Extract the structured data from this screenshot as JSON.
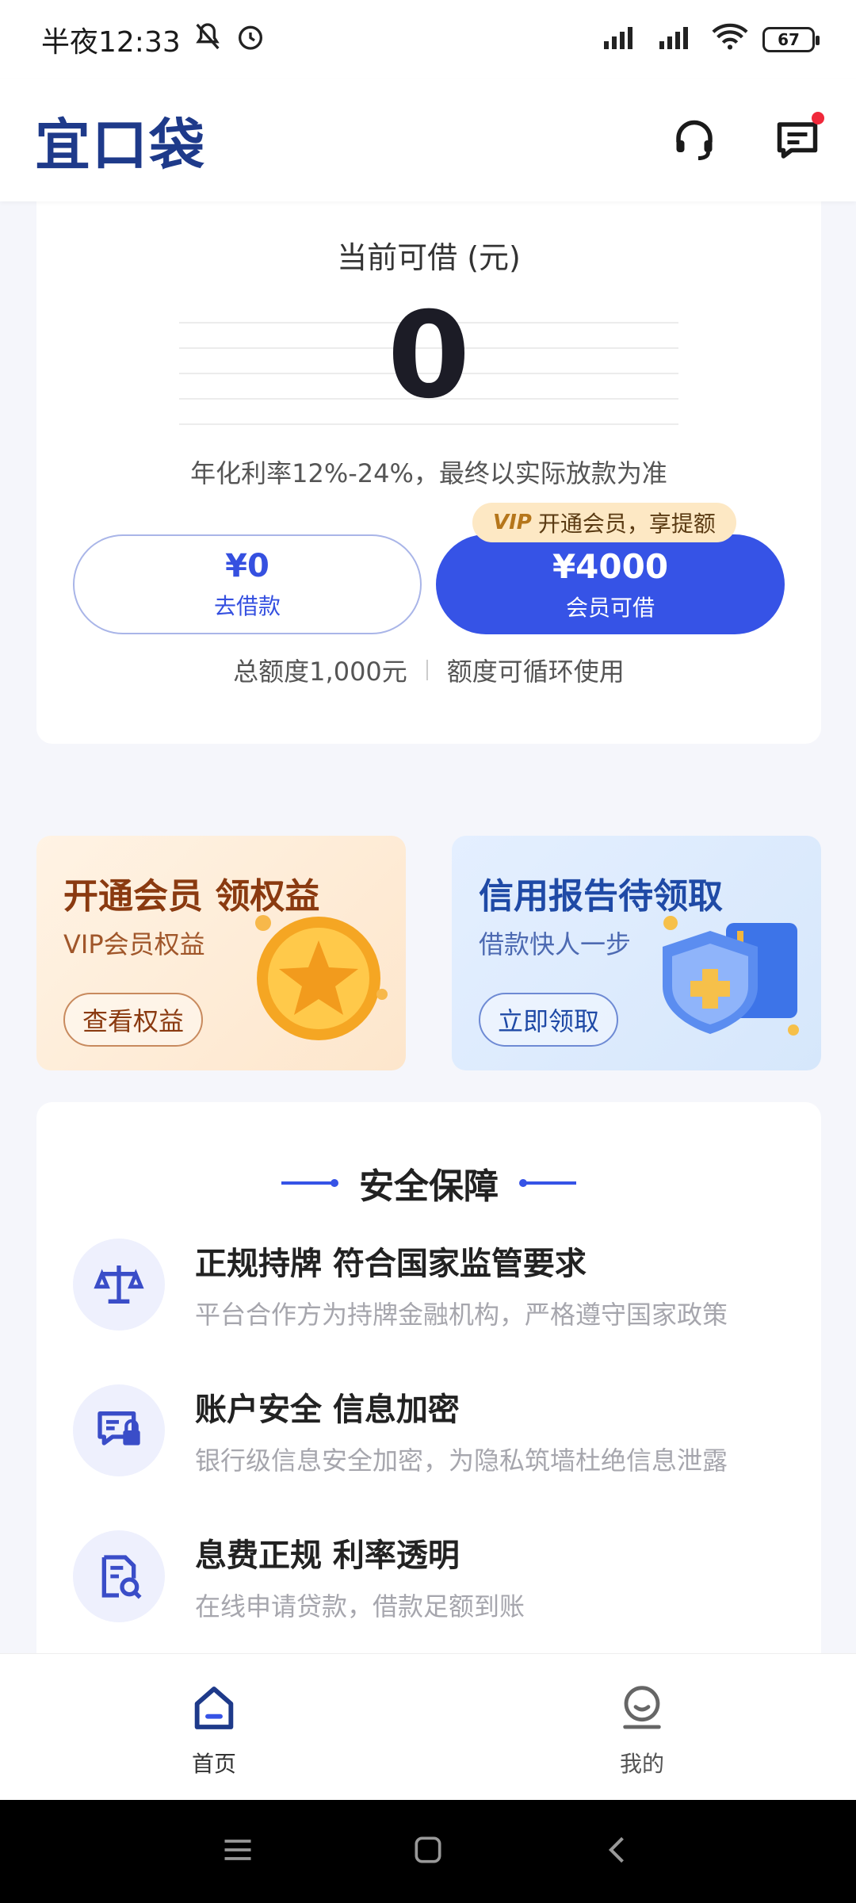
{
  "status_bar": {
    "time": "半夜12:33",
    "battery": "67"
  },
  "header": {
    "logo": "宜口袋"
  },
  "loan": {
    "title": "当前可借 (元)",
    "amount": "0",
    "rate_note": "年化利率12%-24%，最终以实际放款为准",
    "borrow_amount": "¥0",
    "borrow_label": "去借款",
    "vip_mark": "VIP",
    "vip_badge": "开通会员，享提额",
    "member_amount": "¥4000",
    "member_label": "会员可借",
    "total_limit": "总额度1,000元",
    "recycle_note": "额度可循环使用"
  },
  "promos": [
    {
      "title": "开通会员 领权益",
      "subtitle": "VIP会员权益",
      "button": "查看权益"
    },
    {
      "title": "信用报告待领取",
      "subtitle": "借款快人一步",
      "button": "立即领取"
    }
  ],
  "safety": {
    "title": "安全保障",
    "features": [
      {
        "title": "正规持牌 符合国家监管要求",
        "desc": "平台合作方为持牌金融机构，严格遵守国家政策",
        "icon": "scale-icon"
      },
      {
        "title": "账户安全 信息加密",
        "desc": "银行级信息安全加密，为隐私筑墙杜绝信息泄露",
        "icon": "secure-message-icon"
      },
      {
        "title": "息费正规  利率透明",
        "desc": "在线申请贷款，借款足额到账",
        "icon": "document-search-icon"
      }
    ]
  },
  "nav": {
    "home": "首页",
    "mine": "我的"
  },
  "colors": {
    "primary": "#3653e6",
    "brand": "#1e3a8a",
    "vip_badge_bg": "#fde8c4"
  }
}
